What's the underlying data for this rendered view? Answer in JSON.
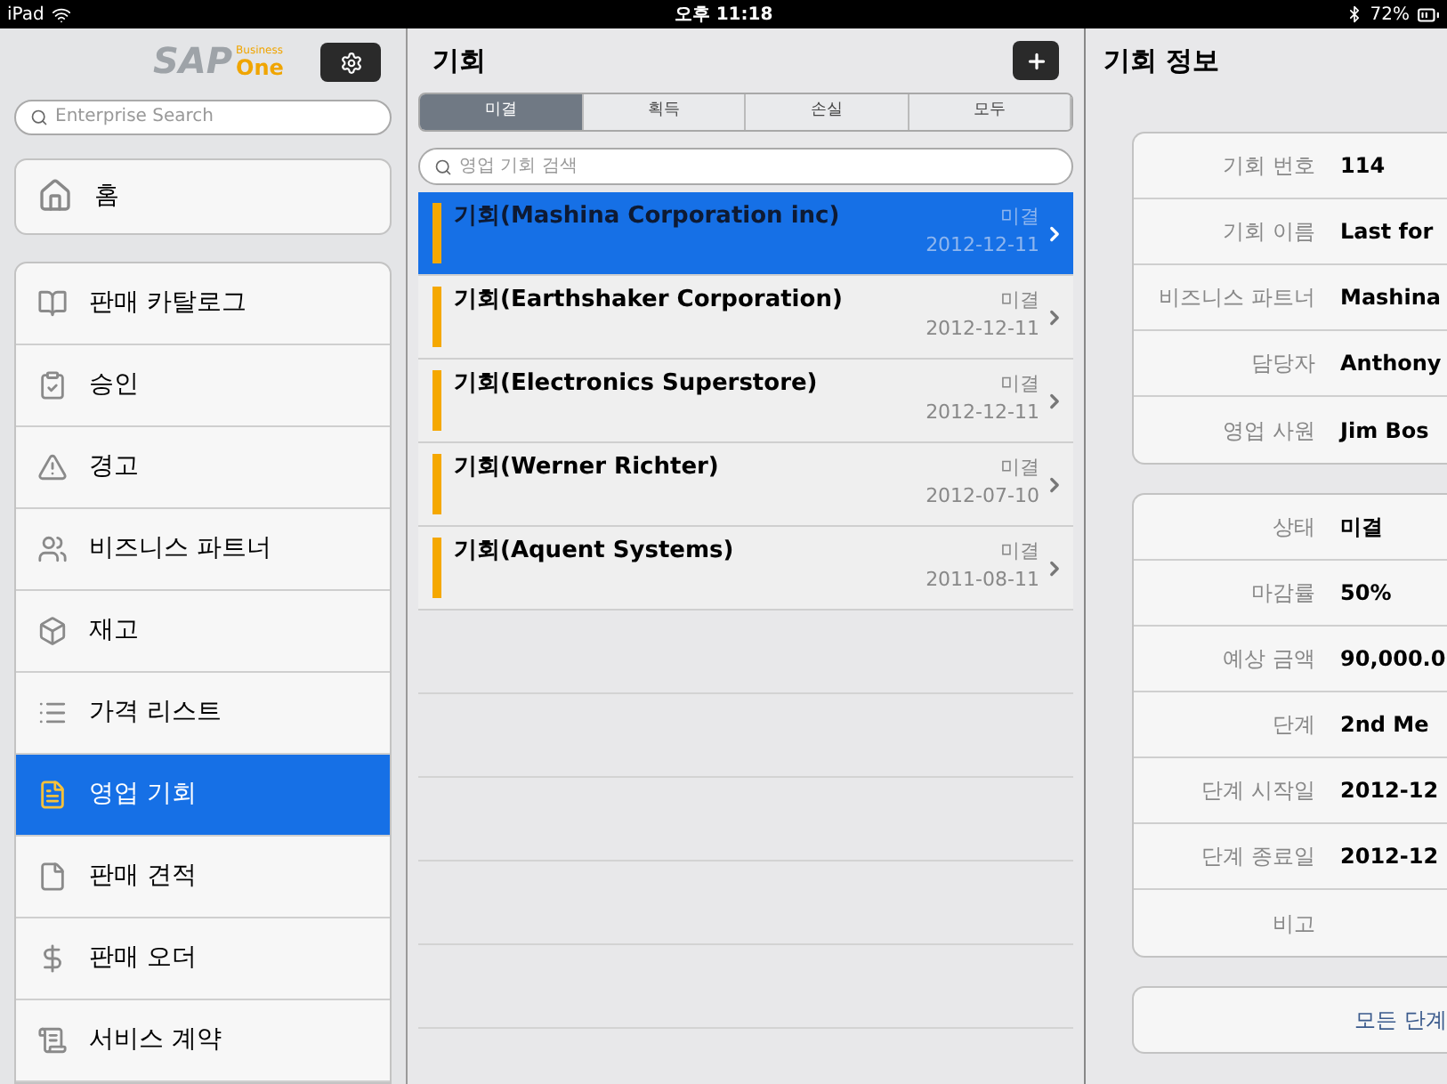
{
  "status_bar": {
    "device": "iPad",
    "time": "오후 11:18",
    "battery": "72%"
  },
  "sidebar": {
    "logo": {
      "brand": "SAP",
      "sub_top": "Business",
      "sub_bottom": "One"
    },
    "search": {
      "placeholder": "Enterprise Search"
    },
    "home": {
      "label": "홈",
      "selected": false
    },
    "items": [
      {
        "label": "판매 카탈로그",
        "selected": false
      },
      {
        "label": "승인",
        "selected": false
      },
      {
        "label": "경고",
        "selected": false
      },
      {
        "label": "비즈니스 파트너",
        "selected": false
      },
      {
        "label": "재고",
        "selected": false
      },
      {
        "label": "가격 리스트",
        "selected": false
      },
      {
        "label": "영업 기회",
        "selected": true
      },
      {
        "label": "판매 견적",
        "selected": false
      },
      {
        "label": "판매 오더",
        "selected": false
      },
      {
        "label": "서비스 계약",
        "selected": false
      }
    ]
  },
  "list": {
    "title": "기회",
    "tabs": [
      {
        "label": "미결",
        "selected": true
      },
      {
        "label": "획득",
        "selected": false
      },
      {
        "label": "손실",
        "selected": false
      },
      {
        "label": "모두",
        "selected": false
      }
    ],
    "search": {
      "placeholder": "영업 기회 검색"
    },
    "rows": [
      {
        "title": "기회(Mashina Corporation inc)",
        "status": "미결",
        "date": "2012-12-11",
        "selected": true
      },
      {
        "title": "기회(Earthshaker Corporation)",
        "status": "미결",
        "date": "2012-12-11",
        "selected": false
      },
      {
        "title": "기회(Electronics Superstore)",
        "status": "미결",
        "date": "2012-12-11",
        "selected": false
      },
      {
        "title": "기회(Werner Richter)",
        "status": "미결",
        "date": "2012-07-10",
        "selected": false
      },
      {
        "title": "기회(Aquent Systems)",
        "status": "미결",
        "date": "2011-08-11",
        "selected": false
      }
    ]
  },
  "detail": {
    "title": "기회 정보",
    "groups": [
      [
        {
          "label": "기회 번호",
          "value": "114"
        },
        {
          "label": "기회 이름",
          "value": "Last for"
        },
        {
          "label": "비즈니스 파트너",
          "value": "Mashina"
        },
        {
          "label": "담당자",
          "value": "Anthony"
        },
        {
          "label": "영업 사원",
          "value": "Jim Bos"
        }
      ],
      [
        {
          "label": "상태",
          "value": "미결"
        },
        {
          "label": "마감률",
          "value": "50%"
        },
        {
          "label": "예상 금액",
          "value": "90,000.0"
        },
        {
          "label": "단계",
          "value": "2nd Me"
        },
        {
          "label": "단계 시작일",
          "value": "2012-12"
        },
        {
          "label": "단계 종료일",
          "value": "2012-12"
        },
        {
          "label": "비고"
        }
      ]
    ],
    "all_stages_button": "모든 단계"
  }
}
